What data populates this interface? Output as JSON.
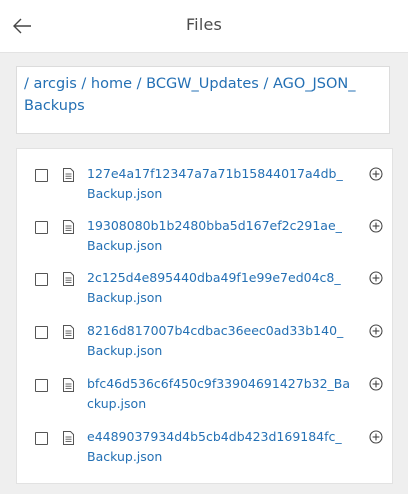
{
  "header": {
    "title": "Files",
    "back_icon": "arrow-left-icon"
  },
  "breadcrumb": [
    {
      "label": "arcgis"
    },
    {
      "label": "home"
    },
    {
      "label": "BCGW_Updates"
    },
    {
      "label": "AGO_JSON_Backups"
    }
  ],
  "files": [
    {
      "line1": "127e4a17f12347a7a71b15844017a4db_",
      "line2": "Backup.json"
    },
    {
      "line1": "19308080b1b2480bba5d167ef2c291ae_",
      "line2": "Backup.json"
    },
    {
      "line1": "2c125d4e895440dba49f1e99e7ed04c8_",
      "line2": "Backup.json"
    },
    {
      "line1": "8216d817007b4cdbac36eec0ad33b140_",
      "line2": "Backup.json"
    },
    {
      "line1": "bfc46d536c6f450c9f33904691427b32_Ba",
      "line2": "ckup.json"
    },
    {
      "line1": "e4489037934d4b5cb4db423d169184fc_",
      "line2": "Backup.json"
    }
  ],
  "icons": {
    "file": "file-text-icon",
    "add": "plus-circle-icon"
  },
  "colors": {
    "link": "#2470b4",
    "title": "#4c4c4c",
    "background": "#efefef"
  }
}
